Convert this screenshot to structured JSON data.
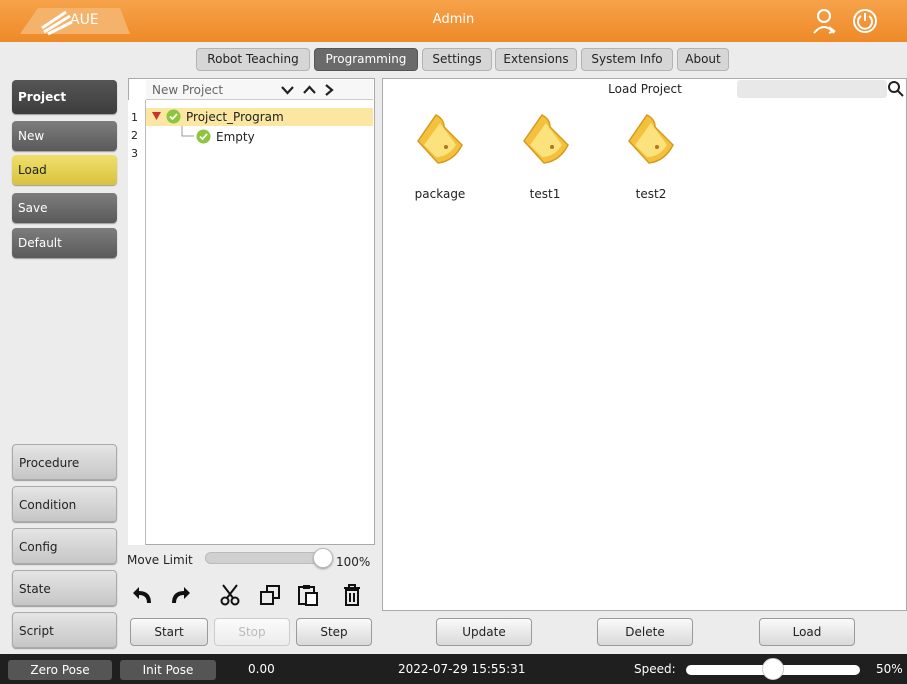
{
  "header": {
    "logo_text": "AUE",
    "title": "Admin",
    "brand_color": "#f09030"
  },
  "tabs": [
    {
      "label": "Robot Teaching",
      "active": false
    },
    {
      "label": "Programming",
      "active": true
    },
    {
      "label": "Settings",
      "active": false
    },
    {
      "label": "Extensions",
      "active": false
    },
    {
      "label": "System Info",
      "active": false
    },
    {
      "label": "About",
      "active": false
    }
  ],
  "sidebar": {
    "section": "Project",
    "items": [
      "New",
      "Load",
      "Save",
      "Default"
    ],
    "selected": "Load",
    "bottom": [
      "Procedure",
      "Condition",
      "Config",
      "State",
      "Script"
    ]
  },
  "tree": {
    "header": "New Project",
    "line_numbers": [
      "1",
      "2",
      "3"
    ],
    "rows": [
      {
        "label": "Project_Program",
        "icon": "check-circle-icon",
        "expanded": true
      },
      {
        "label": "Empty",
        "icon": "check-circle-icon"
      }
    ]
  },
  "load_panel": {
    "title": "Load Project",
    "search_placeholder": "",
    "folders": [
      "package",
      "test1",
      "test2"
    ]
  },
  "move_limit": {
    "label": "Move Limit",
    "value_text": "100%",
    "value": 1.0
  },
  "toolbar_icons": [
    "undo-icon",
    "redo-icon",
    "cut-icon",
    "copy-icon",
    "paste-icon",
    "delete-icon"
  ],
  "run_buttons": {
    "start": "Start",
    "stop": "Stop",
    "step": "Step"
  },
  "action_buttons": {
    "update": "Update",
    "delete": "Delete",
    "load": "Load"
  },
  "statusbar": {
    "zero_pose": "Zero Pose",
    "init_pose": "Init Pose",
    "value": "0.00",
    "datetime": "2022-07-29 15:55:31",
    "speed_label": "Speed:",
    "speed_text": "50%",
    "speed": 0.5
  }
}
